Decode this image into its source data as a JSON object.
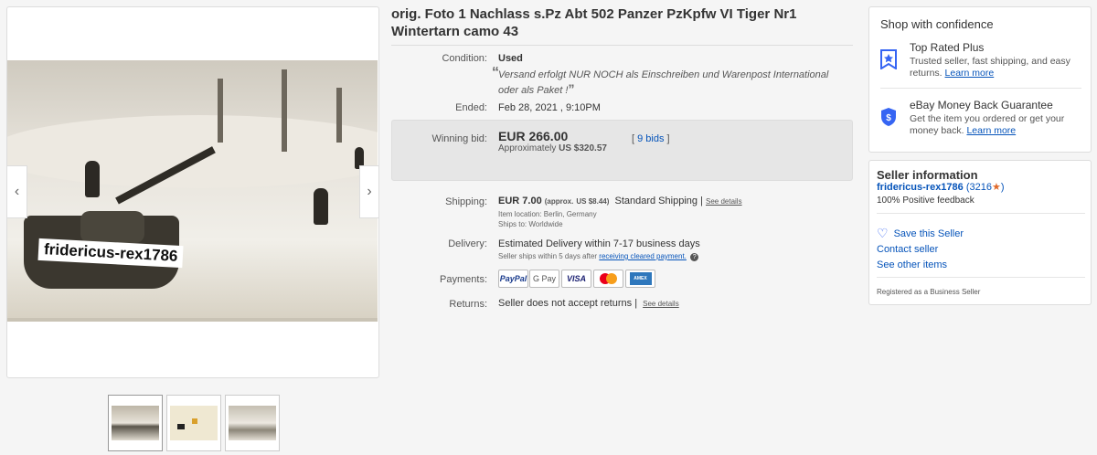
{
  "listing": {
    "title": "orig. Foto 1 Nachlass s.Pz Abt 502 Panzer PzKpfw VI Tiger Nr1 Wintertarn camo 43",
    "watermark": "fridericus-rex1786",
    "thumbs_count": 3
  },
  "details": {
    "condition_label": "Condition:",
    "condition_value": "Used",
    "condition_note": "Versand erfolgt NUR NOCH als Einschreiben und Warenpost International oder als Paket !",
    "ended_label": "Ended:",
    "ended_value": "Feb 28, 2021 , 9:10PM",
    "winning_bid_label": "Winning bid:",
    "winning_bid_value": "EUR 266.00",
    "approx_label": "Approximately",
    "approx_value": "US $320.57",
    "bids_link": "9 bids",
    "shipping_label": "Shipping:",
    "shipping_value": "EUR 7.00",
    "shipping_approx": "(approx.",
    "shipping_approx_us": "US $8.44)",
    "shipping_method": "Standard Shipping |",
    "shipping_see_details": "See details",
    "item_location": "Item location:  Berlin, Germany",
    "ships_to": "Ships to:  Worldwide",
    "delivery_label": "Delivery:",
    "delivery_value": "Estimated Delivery within 7-17 business days",
    "delivery_note": "Seller ships within 5 days after",
    "delivery_link": "receiving cleared payment.",
    "payments_label": "Payments:",
    "payment_methods": [
      "PayPal",
      "G Pay",
      "VISA",
      "Mastercard",
      "AMEX"
    ],
    "returns_label": "Returns:",
    "returns_value": "Seller does not accept returns |",
    "returns_see_details": "See details"
  },
  "confidence": {
    "title": "Shop with confidence",
    "top_rated_title": "Top Rated Plus",
    "top_rated_text": "Trusted seller, fast shipping, and easy returns.",
    "top_rated_link": "Learn more",
    "mbg_title": "eBay Money Back Guarantee",
    "mbg_text": "Get the item you ordered or get your money back.",
    "mbg_link": "Learn more"
  },
  "seller": {
    "title": "Seller information",
    "name": "fridericus-rex1786",
    "score": "(3216",
    "score_close": ")",
    "feedback": "100% Positive feedback",
    "save": "Save this Seller",
    "contact": "Contact seller",
    "other_items": "See other items",
    "registered": "Registered as a Business Seller"
  }
}
